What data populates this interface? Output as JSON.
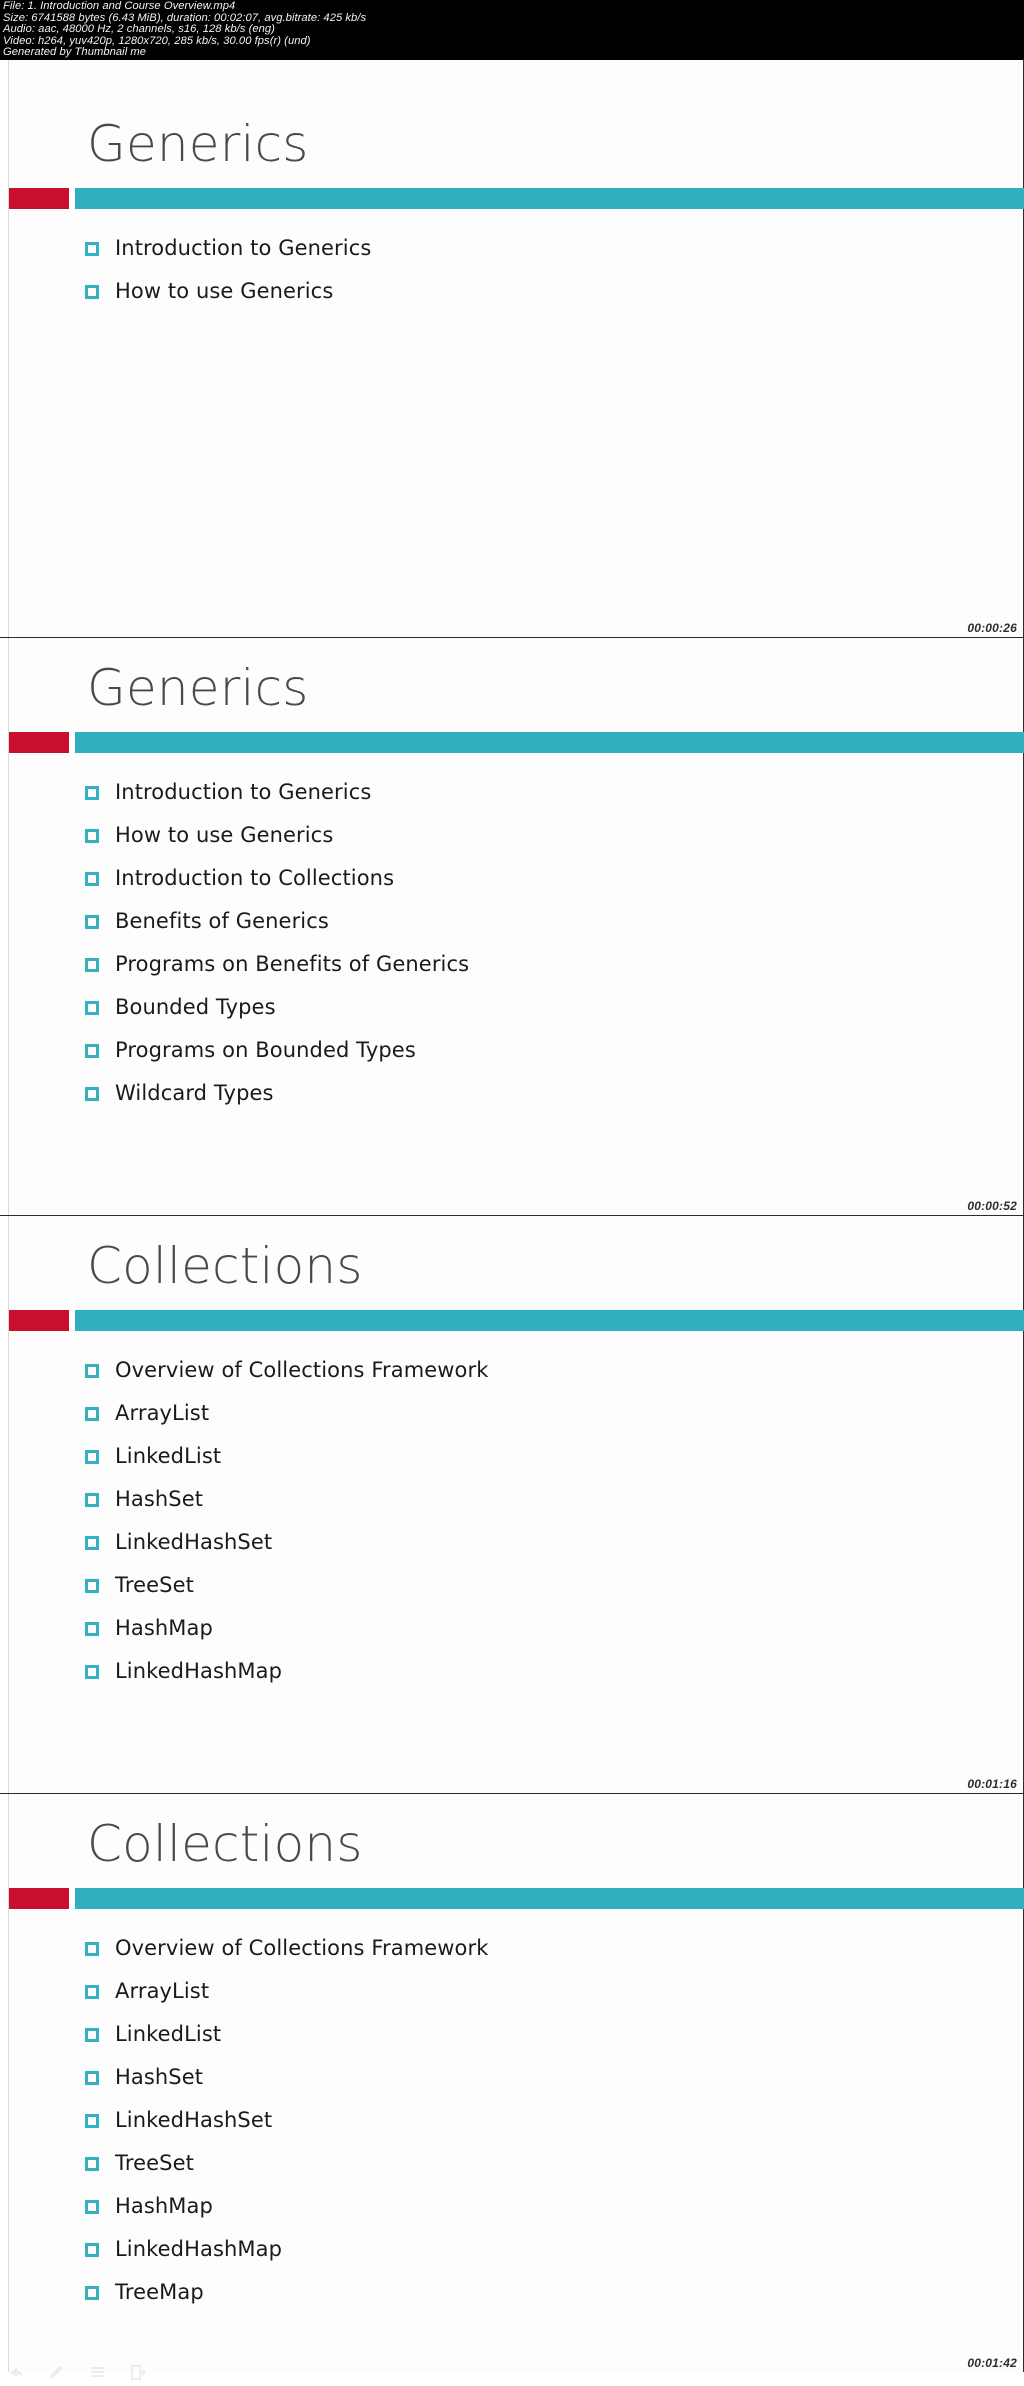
{
  "info_header": {
    "lines": [
      "File: 1. Introduction and Course Overview.mp4",
      "Size: 6741588 bytes (6.43 MiB), duration: 00:02:07, avg.bitrate: 425 kb/s",
      "Audio: aac, 48000 Hz, 2 channels, s16, 128 kb/s (eng)",
      "Video: h264, yuv420p, 1280x720, 285 kb/s, 30.00 fps(r) (und)",
      "Generated by Thumbnail me"
    ]
  },
  "colors": {
    "accent_red": "#c8102e",
    "accent_teal": "#31aec0",
    "bullet_teal": "#35b0c0",
    "title_gray": "#4a4a4a",
    "header_background": "#000000"
  },
  "slides": [
    {
      "title": "Generics",
      "timestamp": "00:00:26",
      "items": [
        "Introduction to Generics",
        "How to use Generics"
      ]
    },
    {
      "title": "Generics",
      "timestamp": "00:00:52",
      "items": [
        "Introduction to Generics",
        "How to use Generics",
        "Introduction to Collections",
        "Benefits of Generics",
        "Programs on Benefits of Generics",
        "Bounded Types",
        "Programs on Bounded Types",
        "Wildcard Types"
      ]
    },
    {
      "title": "Collections",
      "timestamp": "00:01:16",
      "items": [
        "Overview of Collections Framework",
        "ArrayList",
        "LinkedList",
        "HashSet",
        "LinkedHashSet",
        "TreeSet",
        "HashMap",
        "LinkedHashMap"
      ]
    },
    {
      "title": "Collections",
      "timestamp": "00:01:42",
      "items": [
        "Overview of Collections Framework",
        "ArrayList",
        "LinkedList",
        "HashSet",
        "LinkedHashSet",
        "TreeSet",
        "HashMap",
        "LinkedHashMap",
        "TreeMap"
      ]
    }
  ],
  "bottom_toolbar": {
    "icons": [
      "back-arrow-icon",
      "pencil-icon",
      "list-icon",
      "exit-arrow-icon"
    ]
  }
}
